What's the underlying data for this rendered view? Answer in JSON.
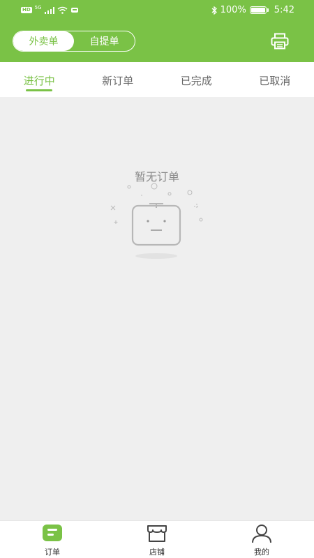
{
  "status_bar": {
    "network_badge": "HD",
    "network_type": "5G",
    "battery_percent": "100%",
    "time": "5:42"
  },
  "header": {
    "segment": {
      "options": [
        "外卖单",
        "自提单"
      ],
      "selected": "外卖单"
    },
    "printer_icon": "printer-icon"
  },
  "tabs": {
    "items": [
      "进行中",
      "新订单",
      "已完成",
      "已取消"
    ],
    "active": "进行中"
  },
  "empty_state": {
    "message": "暂无订单",
    "illustration": "empty-box-face-icon"
  },
  "bottom_nav": {
    "items": [
      {
        "label": "订单",
        "icon": "orders-icon",
        "active": true
      },
      {
        "label": "店铺",
        "icon": "store-icon",
        "active": false
      },
      {
        "label": "我的",
        "icon": "profile-icon",
        "active": false
      }
    ]
  },
  "colors": {
    "accent": "#7ac246",
    "background": "#efefef",
    "text_muted": "#8a8a8a"
  }
}
